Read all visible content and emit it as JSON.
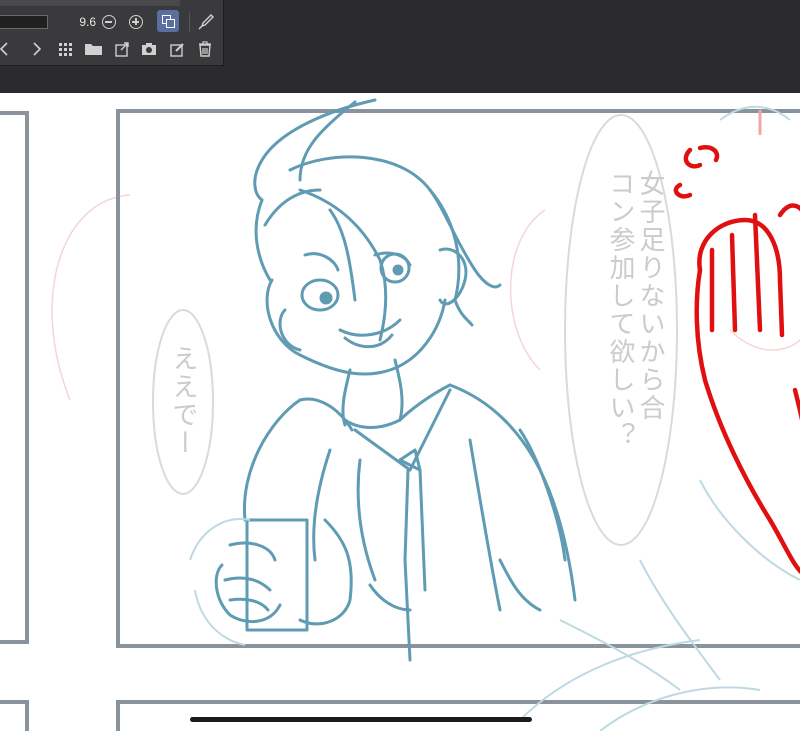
{
  "toolbar": {
    "brush_size_value": "9.6",
    "icons": [
      "zoom-out-icon",
      "zoom-in-icon",
      "sync-icon",
      "eyedropper-icon",
      "chevron-left-icon",
      "chevron-right-icon",
      "grid-icon",
      "folder-icon",
      "import-icon",
      "camera-icon",
      "edit-icon",
      "trash-icon"
    ]
  },
  "canvas": {
    "speech_bubble_right": "女子足りないから合コン参加して欲しい？",
    "speech_bubble_left": "ええでー"
  },
  "colors": {
    "topbar": "#2b2b2d",
    "palette": "#3a3a3c",
    "accent": "#5a6fa0",
    "sketch_blue": "#5f9bb3",
    "sketch_red": "#e01010",
    "panel_border": "#8a929c"
  }
}
